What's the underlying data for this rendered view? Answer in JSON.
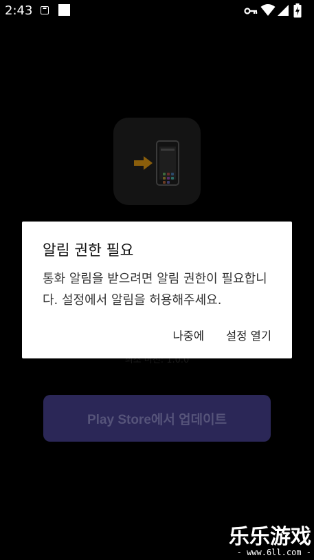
{
  "status_bar": {
    "time": "2:43"
  },
  "background": {
    "version_text": "최소 버전: 1.0.0",
    "update_button_label": "Play Store에서 업데이트"
  },
  "dialog": {
    "title": "알림 권한 필요",
    "message": "통화 알림을 받으려면 알림 권한이 필요합니다. 설정에서 알림을 허용해주세요.",
    "later_label": "나중에",
    "open_settings_label": "설정 열기"
  },
  "watermark": {
    "main": "乐乐游戏",
    "sub": "- www.6ll.com -"
  },
  "colors": {
    "scrim": "#000000",
    "dialog_bg": "#ffffff",
    "button_bg": "#2b2757",
    "arrow": "#d08e10"
  }
}
